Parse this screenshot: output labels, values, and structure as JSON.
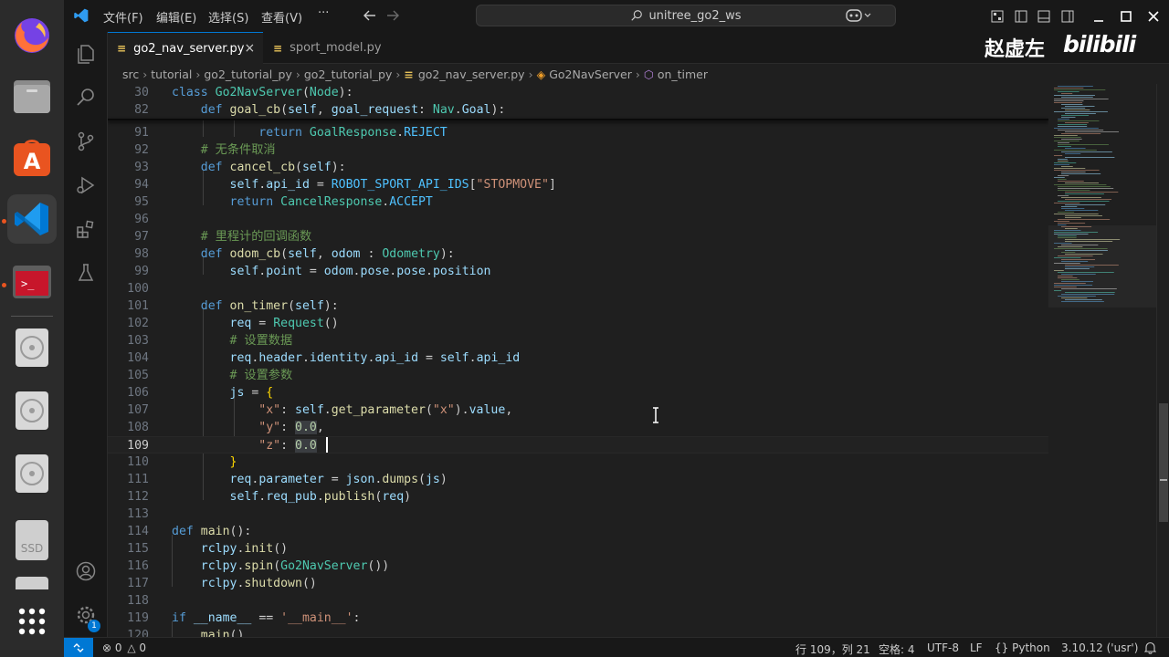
{
  "titlebar": {
    "menus": [
      "文件(F)",
      "编辑(E)",
      "选择(S)",
      "查看(V)",
      "···"
    ],
    "search_text": "unitree_go2_ws"
  },
  "tabs": [
    {
      "label": "go2_nav_server.py",
      "active": true
    },
    {
      "label": "sport_model.py",
      "active": false
    }
  ],
  "breadcrumb": [
    "src",
    "tutorial",
    "go2_tutorial_py",
    "go2_tutorial_py",
    "go2_nav_server.py",
    "Go2NavServer",
    "on_timer"
  ],
  "editor": {
    "sticky_lines": [
      {
        "n": "30",
        "text": "class Go2NavServer(Node):"
      },
      {
        "n": "82",
        "text": "    def goal_cb(self, goal_request: Nav.Goal):"
      }
    ],
    "lines": [
      {
        "n": "91",
        "text": "            return GoalResponse.REJECT"
      },
      {
        "n": "92",
        "text": "    # 无条件取消"
      },
      {
        "n": "93",
        "text": "    def cancel_cb(self):"
      },
      {
        "n": "94",
        "text": "        self.api_id = ROBOT_SPORT_API_IDS[\"STOPMOVE\"]"
      },
      {
        "n": "95",
        "text": "        return CancelResponse.ACCEPT"
      },
      {
        "n": "96",
        "text": ""
      },
      {
        "n": "97",
        "text": "    # 里程计的回调函数"
      },
      {
        "n": "98",
        "text": "    def odom_cb(self, odom : Odometry):"
      },
      {
        "n": "99",
        "text": "        self.point = odom.pose.pose.position"
      },
      {
        "n": "100",
        "text": ""
      },
      {
        "n": "101",
        "text": "    def on_timer(self):"
      },
      {
        "n": "102",
        "text": "        req = Request()"
      },
      {
        "n": "103",
        "text": "        # 设置数据"
      },
      {
        "n": "104",
        "text": "        req.header.identity.api_id = self.api_id"
      },
      {
        "n": "105",
        "text": "        # 设置参数"
      },
      {
        "n": "106",
        "text": "        js = {"
      },
      {
        "n": "107",
        "text": "            \"x\": self.get_parameter(\"x\").value,"
      },
      {
        "n": "108",
        "text": "            \"y\": 0.0,"
      },
      {
        "n": "109",
        "text": "            \"z\": 0.0"
      },
      {
        "n": "110",
        "text": "        }"
      },
      {
        "n": "111",
        "text": "        req.parameter = json.dumps(js)"
      },
      {
        "n": "112",
        "text": "        self.req_pub.publish(req)"
      },
      {
        "n": "113",
        "text": ""
      },
      {
        "n": "114",
        "text": "def main():"
      },
      {
        "n": "115",
        "text": "    rclpy.init()"
      },
      {
        "n": "116",
        "text": "    rclpy.spin(Go2NavServer())"
      },
      {
        "n": "117",
        "text": "    rclpy.shutdown()"
      },
      {
        "n": "118",
        "text": ""
      },
      {
        "n": "119",
        "text": "if __name__ == '__main__':"
      },
      {
        "n": "120",
        "text": "    main()"
      }
    ],
    "current_line": "109"
  },
  "statusbar": {
    "problems": "0",
    "warnings": "0",
    "position": "行 109，列 21",
    "spaces": "空格: 4",
    "encoding": "UTF-8",
    "eol": "LF",
    "language": "Python",
    "interpreter": "3.10.12 ('usr')"
  },
  "watermark": {
    "author": "赵虚左",
    "logo": "bilibili"
  },
  "dock": {
    "ssd_label": "SSD",
    "settings_badge": "1"
  },
  "colors": {
    "accent": "#0078d4",
    "ubuntu_orange": "#e95420",
    "editor_bg": "#1f1f1f"
  },
  "icons": [
    "firefox-icon",
    "files-icon",
    "app-center-icon",
    "vscode-icon",
    "terminal-icon",
    "disc-icon",
    "ssd-icon",
    "show-apps-icon",
    "explorer-icon",
    "search-icon",
    "source-control-icon",
    "run-debug-icon",
    "extensions-icon",
    "testing-icon",
    "account-icon",
    "manage-gear-icon"
  ]
}
